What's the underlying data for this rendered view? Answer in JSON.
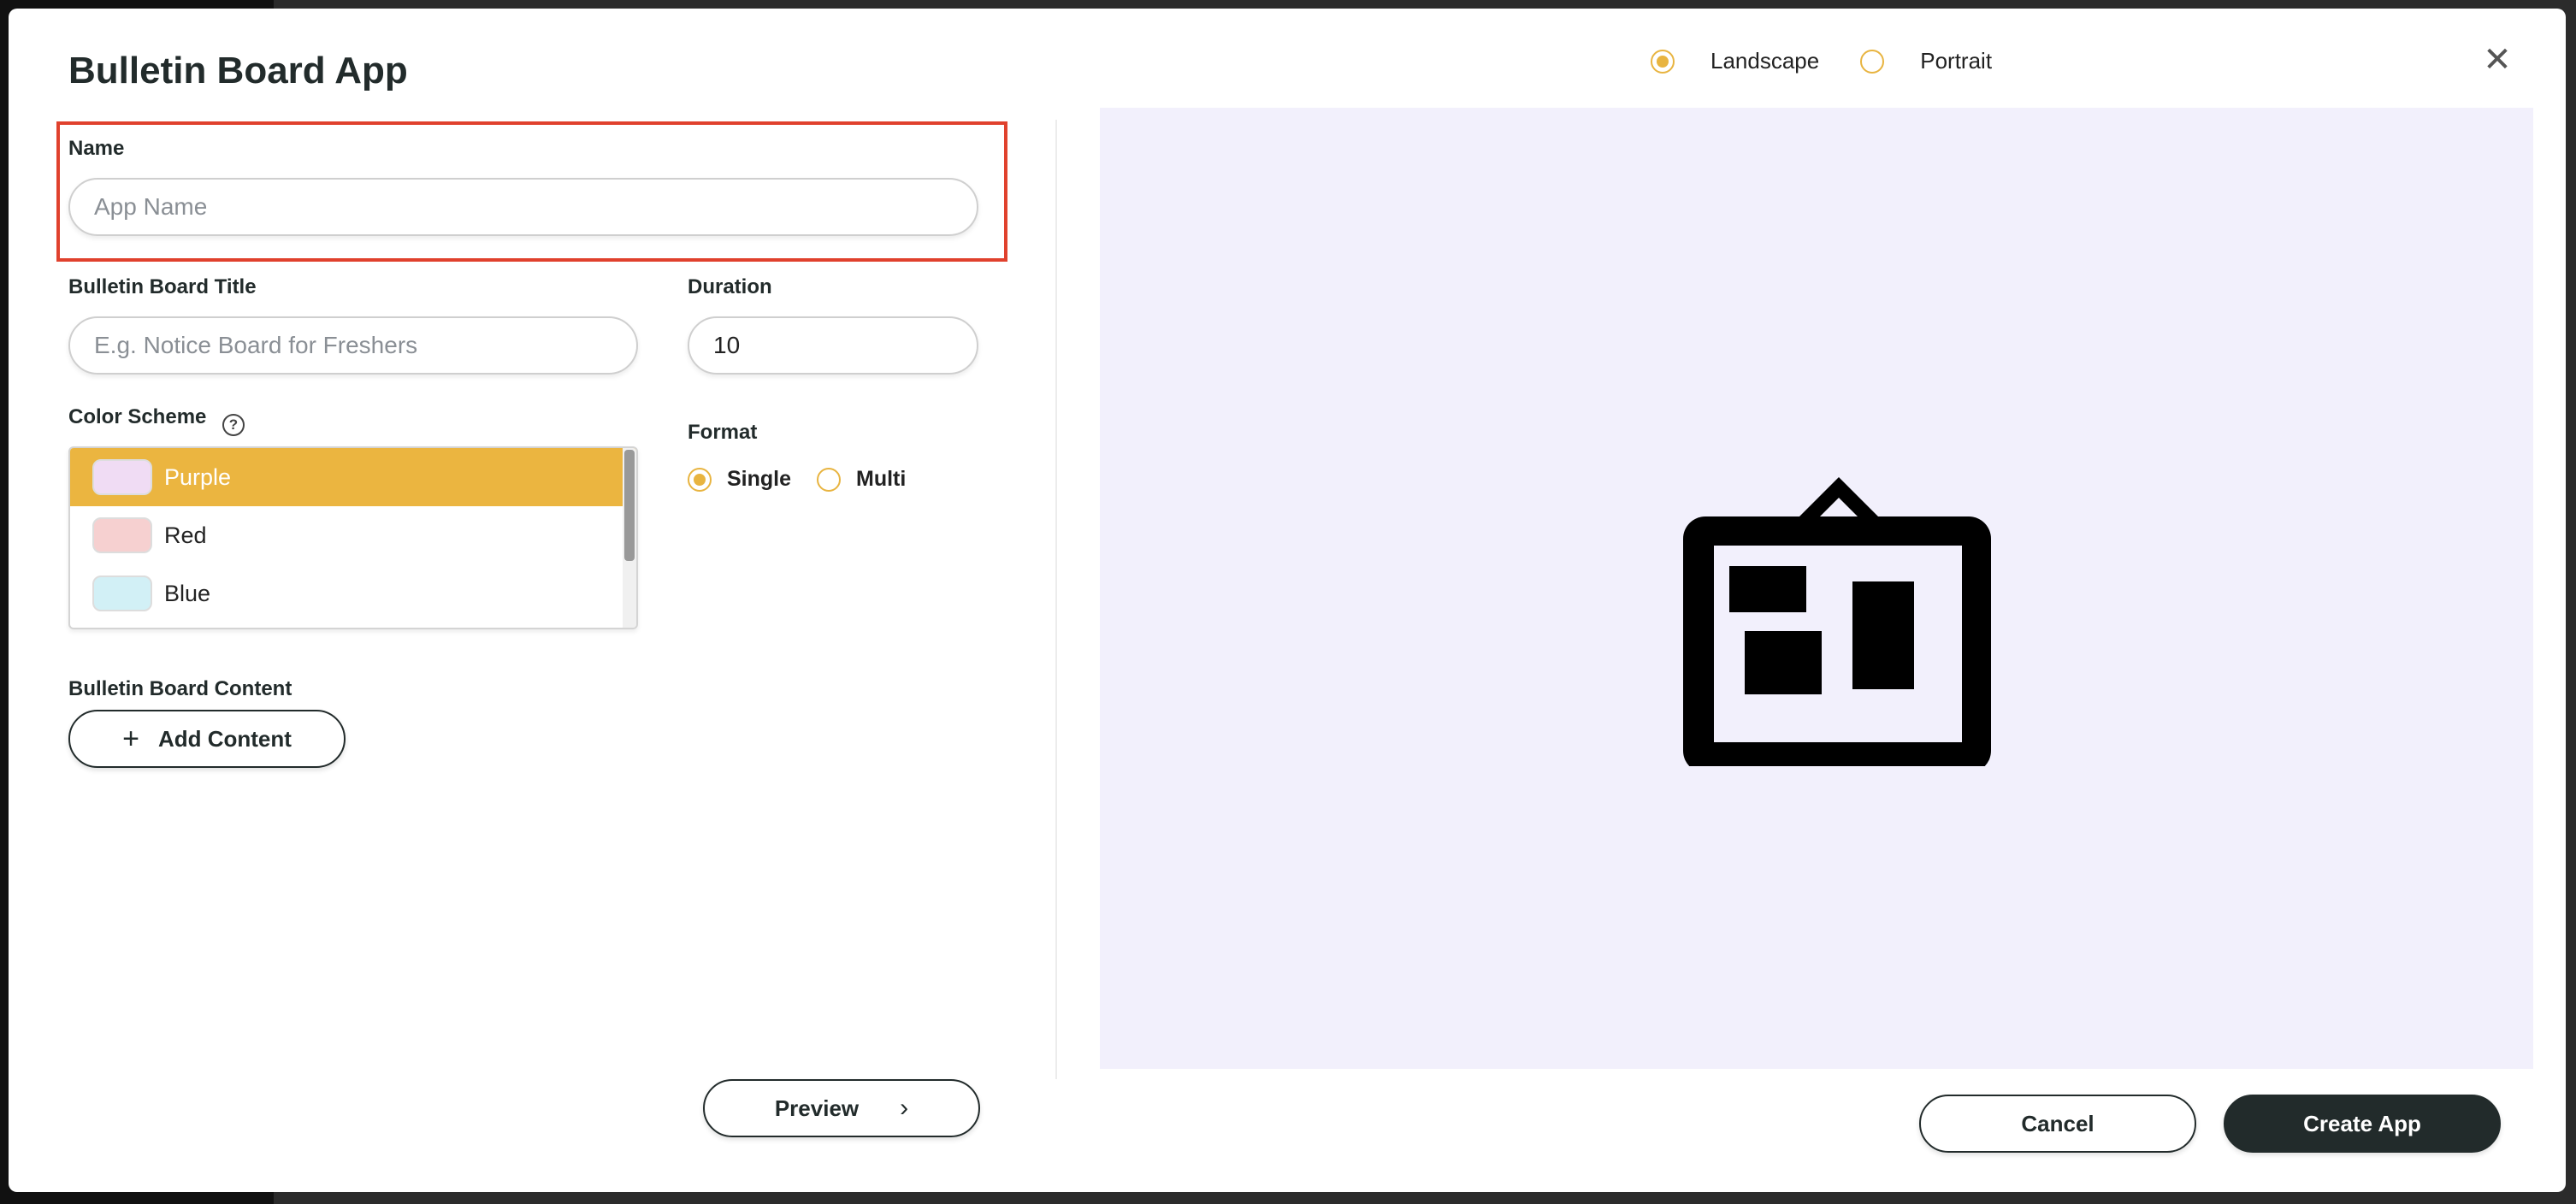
{
  "modal": {
    "title": "Bulletin Board App",
    "close_label": "✕"
  },
  "orientation": {
    "options": [
      {
        "label": "Landscape",
        "checked": true
      },
      {
        "label": "Portrait",
        "checked": false
      }
    ]
  },
  "form": {
    "name_label": "Name",
    "name_placeholder": "App Name",
    "title_label": "Bulletin Board Title",
    "title_placeholder": "E.g. Notice Board for Freshers",
    "duration_label": "Duration",
    "duration_value": "10",
    "color_scheme_label": "Color Scheme",
    "help_glyph": "?",
    "color_options": [
      {
        "label": "Purple",
        "swatch": "#f0dcf4",
        "selected": true
      },
      {
        "label": "Red",
        "swatch": "#f6d0d0",
        "selected": false
      },
      {
        "label": "Blue",
        "swatch": "#d2f0f6",
        "selected": false
      }
    ],
    "format_label": "Format",
    "format_options": [
      {
        "label": "Single",
        "checked": true
      },
      {
        "label": "Multi",
        "checked": false
      }
    ],
    "content_label": "Bulletin Board Content",
    "add_content_label": "Add Content",
    "add_content_glyph": "+"
  },
  "footer": {
    "preview_label": "Preview",
    "preview_glyph": "›",
    "cancel_label": "Cancel",
    "create_label": "Create App"
  },
  "colors": {
    "accent": "#ebb540",
    "highlight": "#e0412d",
    "dark": "#222b2b",
    "preview_bg": "#f2f0fc"
  }
}
